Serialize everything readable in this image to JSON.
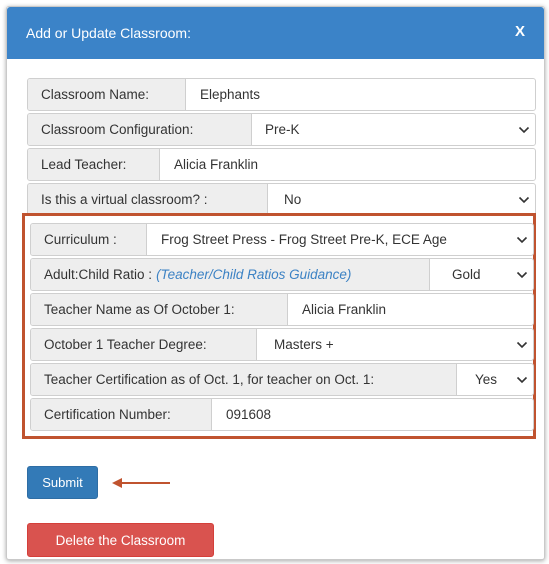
{
  "modal": {
    "title": "Add or Update Classroom:",
    "close_label": "X"
  },
  "fields": {
    "classroom_name": {
      "label": "Classroom Name:",
      "value": "Elephants"
    },
    "classroom_config": {
      "label": "Classroom Configuration:",
      "value": "Pre-K"
    },
    "lead_teacher": {
      "label": "Lead Teacher:",
      "value": "Alicia Franklin"
    },
    "virtual": {
      "label": "Is this a virtual classroom? :",
      "value": "No"
    },
    "curriculum": {
      "label": "Curriculum :",
      "value": "Frog Street Press - Frog Street Pre-K, ECE Age"
    },
    "ratio": {
      "label": "Adult:Child Ratio :",
      "guidance_link": "(Teacher/Child Ratios Guidance)",
      "value": "Gold"
    },
    "teacher_name_oct1": {
      "label": "Teacher Name as Of October 1:",
      "value": "Alicia Franklin"
    },
    "oct1_degree": {
      "label": "October 1 Teacher Degree:",
      "value": "Masters +"
    },
    "certification": {
      "label": "Teacher Certification as of Oct. 1, for teacher on Oct. 1:",
      "value": "Yes"
    },
    "cert_number": {
      "label": "Certification Number:",
      "value": "091608"
    }
  },
  "actions": {
    "submit_label": "Submit",
    "delete_label": "Delete the Classroom"
  },
  "colors": {
    "header": "#3b83c8",
    "primary_button": "#337ab7",
    "danger_button": "#d9534f",
    "highlight_border": "#c0532f",
    "link": "#3c82c4"
  }
}
